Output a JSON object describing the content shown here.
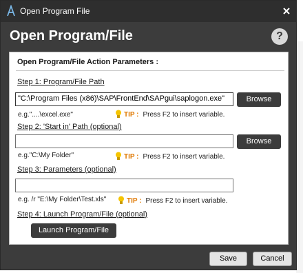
{
  "window": {
    "title": "Open Program File",
    "header": "Open Program/File",
    "help_label": "?"
  },
  "panel": {
    "heading": "Open Program/File Action Parameters :",
    "step1": {
      "label": "Step 1: Program/File Path",
      "value": "\"C:\\Program Files (x86)\\SAP\\FrontEnd\\SAPgui\\saplogon.exe\"",
      "browse_label": "Browse",
      "example": "e.g.\"....\\excel.exe\"",
      "tip_label": "TIP :",
      "tip_text": "Press F2 to insert variable."
    },
    "step2": {
      "label": "Step 2: 'Start in' Path (optional)",
      "value": "",
      "browse_label": "Browse",
      "example": "e.g.\"C:\\My Folder\"",
      "tip_label": "TIP :",
      "tip_text": "Press F2 to insert variable."
    },
    "step3": {
      "label": "Step 3: Parameters (optional)",
      "value": "",
      "example": "e.g. /r  \"E:\\My Folder\\Test.xls\"",
      "tip_label": "TIP :",
      "tip_text": "Press F2 to insert variable."
    },
    "step4": {
      "label": "Step 4: Launch Program/File (optional)",
      "button_label": "Launch Program/File"
    }
  },
  "footer": {
    "save_label": "Save",
    "cancel_label": "Cancel"
  },
  "colors": {
    "window_bg": "#3c3c3c",
    "titlebar_bg": "#2e2e2e",
    "tip_accent": "#e07800",
    "bulb": "#f5c400"
  },
  "icons": {
    "app": "app-logo-icon",
    "close": "close-icon",
    "help": "help-icon",
    "tip": "lightbulb-icon"
  }
}
